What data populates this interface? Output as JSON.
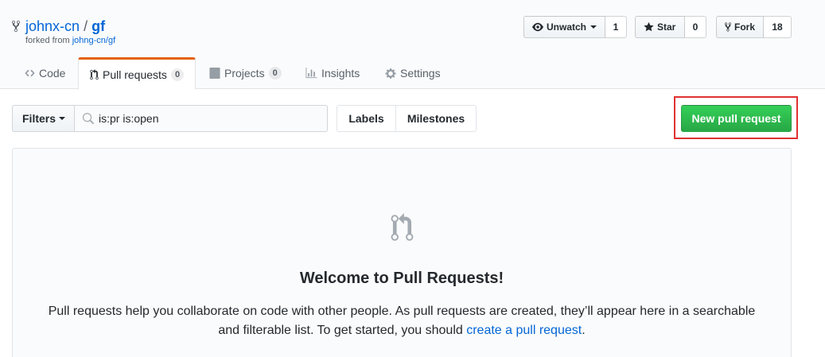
{
  "repo": {
    "owner": "johnx-cn",
    "separator": "/",
    "name": "gf",
    "forked_from_label": "forked from",
    "forked_from_link": "johng-cn/gf"
  },
  "actions": {
    "watch_label": "Unwatch",
    "watch_count": "1",
    "star_label": "Star",
    "star_count": "0",
    "fork_label": "Fork",
    "fork_count": "18"
  },
  "tabs": [
    {
      "label": "Code",
      "icon": "code-icon"
    },
    {
      "label": "Pull requests",
      "icon": "pull-request-icon",
      "counter": "0",
      "selected": true
    },
    {
      "label": "Projects",
      "icon": "project-icon",
      "counter": "0"
    },
    {
      "label": "Insights",
      "icon": "graph-icon"
    },
    {
      "label": "Settings",
      "icon": "gear-icon"
    }
  ],
  "subnav": {
    "filters_label": "Filters",
    "search_value": "is:pr is:open",
    "labels_label": "Labels",
    "milestones_label": "Milestones",
    "new_pr_label": "New pull request"
  },
  "blankslate": {
    "title": "Welcome to Pull Requests!",
    "text_before": "Pull requests help you collaborate on code with other people. As pull requests are created, they’ll appear here in a searchable and filterable list. To get started, you should ",
    "link": "create a pull request",
    "text_after": "."
  },
  "colors": {
    "link": "#0366d6",
    "accent_tab": "#e36209",
    "primary_button": "#28a745",
    "highlight": "#e03131"
  }
}
